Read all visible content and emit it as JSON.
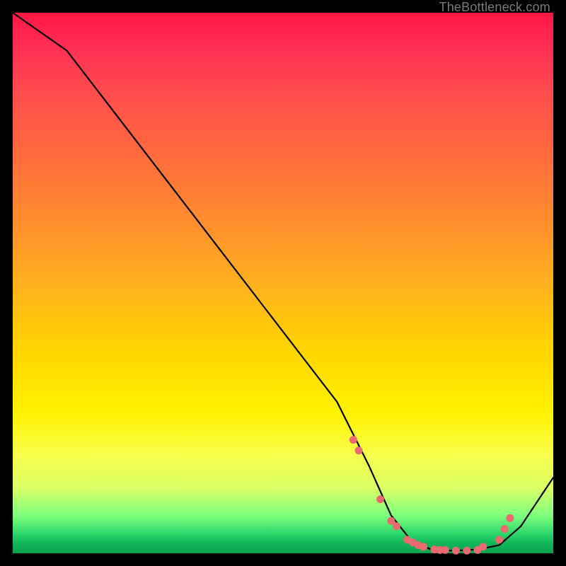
{
  "watermark": "TheBottleneck.com",
  "chart_data": {
    "type": "line",
    "title": "",
    "xlabel": "",
    "ylabel": "",
    "xlim": [
      0,
      100
    ],
    "ylim": [
      0,
      100
    ],
    "series": [
      {
        "name": "curve",
        "x": [
          0,
          10,
          20,
          30,
          40,
          50,
          60,
          66,
          70,
          74,
          78,
          82,
          86,
          90,
          94,
          100
        ],
        "values": [
          100,
          93,
          80,
          67,
          54,
          41,
          28,
          16,
          7,
          2,
          0.5,
          0.5,
          0.7,
          1.5,
          5,
          14
        ]
      }
    ],
    "markers": {
      "name": "highlight-dots",
      "x": [
        63,
        64,
        68,
        70,
        71,
        73,
        74,
        75,
        76,
        78,
        79,
        80,
        82,
        84,
        86,
        87,
        90,
        91,
        92
      ],
      "values": [
        21,
        19,
        10,
        6,
        5,
        2.5,
        2,
        1.5,
        1.2,
        0.7,
        0.6,
        0.6,
        0.5,
        0.5,
        0.6,
        1.2,
        2.5,
        4.5,
        6.5
      ]
    },
    "gradient_bands": [
      {
        "color": "#ff1744",
        "at": 100
      },
      {
        "color": "#ffb01f",
        "at": 50
      },
      {
        "color": "#fff200",
        "at": 26
      },
      {
        "color": "#2bd66a",
        "at": 3
      },
      {
        "color": "#0aa04f",
        "at": 0
      }
    ]
  }
}
